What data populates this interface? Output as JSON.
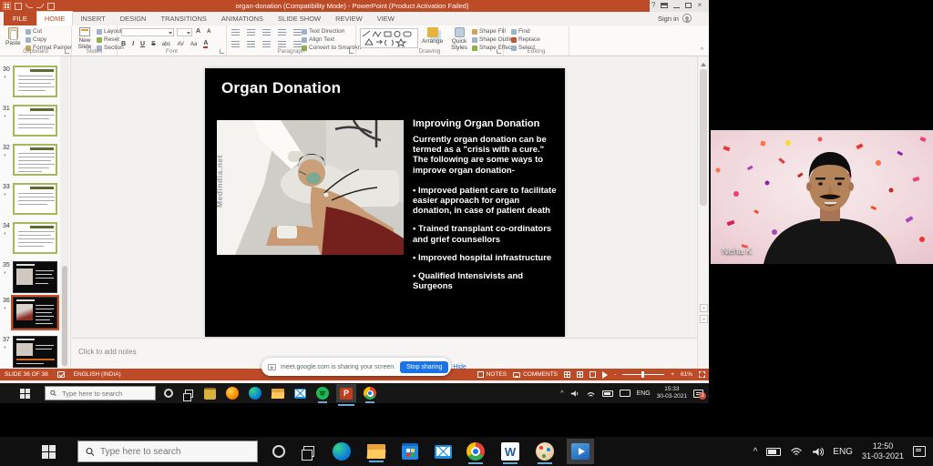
{
  "pp": {
    "title": "organ-donation (Compatibility Mode) - PowerPoint (Product Activation Failed)",
    "sign_in": "Sign in",
    "tabs": [
      "FILE",
      "HOME",
      "INSERT",
      "DESIGN",
      "TRANSITIONS",
      "ANIMATIONS",
      "SLIDE SHOW",
      "REVIEW",
      "VIEW"
    ],
    "ribbon": {
      "clipboard": {
        "group": "Clipboard",
        "paste": "Paste",
        "cut": "Cut",
        "copy": "Copy",
        "format_painter": "Format Painter"
      },
      "slides": {
        "group": "Slides",
        "new_slide": "New Slide",
        "layout": "Layout",
        "reset": "Reset",
        "section": "Section"
      },
      "font": {
        "group": "Font",
        "bold": "B",
        "italic": "I",
        "underline": "U",
        "strike": "S",
        "shadow": "abc",
        "spacing": "AV",
        "case": "Aa",
        "color": "A"
      },
      "paragraph": {
        "group": "Paragraph",
        "text_direction": "Text Direction",
        "align_text": "Align Text",
        "convert_smartart": "Convert to SmartArt"
      },
      "drawing": {
        "group": "Drawing",
        "arrange": "Arrange",
        "quick_styles": "Quick Styles",
        "shape_fill": "Shape Fill",
        "shape_outline": "Shape Outline",
        "shape_effects": "Shape Effects"
      },
      "editing": {
        "group": "Editing",
        "find": "Find",
        "replace": "Replace",
        "select": "Select"
      }
    },
    "thumbnails": [
      {
        "number": "30"
      },
      {
        "number": "31"
      },
      {
        "number": "32"
      },
      {
        "number": "33"
      },
      {
        "number": "34"
      },
      {
        "number": "35"
      },
      {
        "number": "36"
      },
      {
        "number": "37"
      }
    ],
    "slide": {
      "title": "Organ Donation",
      "watermark": "Medindia.net",
      "heading": "Improving Organ Donation",
      "intro": "Currently organ donation can be termed as a \"crisis with a cure.\" The following are some ways to improve organ donation-",
      "bullets": [
        "• Improved patient care to facilitate easier approach for organ donation, in case of patient death",
        "• Trained transplant co-ordinators and grief counsellors",
        "• Improved hospital infrastructure",
        "• Qualified Intensivists and Surgeons"
      ]
    },
    "notes_placeholder": "Click to add notes",
    "status": {
      "slide_counter": "SLIDE 36 OF 38",
      "language": "ENGLISH (INDIA)",
      "notes": "NOTES",
      "comments": "COMMENTS",
      "zoom": "61%"
    }
  },
  "meet_banner": {
    "message": "meet.google.com is sharing your screen.",
    "stop_button": "Stop sharing",
    "hide_link": "Hide",
    "accent": "#1A73E8"
  },
  "shared_taskbar": {
    "search_placeholder": "Type here to search",
    "language": "ENG",
    "time": "15:33",
    "date": "30-03-2021",
    "notification_count": "3"
  },
  "video": {
    "participant_name": "Neha K"
  },
  "local_taskbar": {
    "search_placeholder": "Type here to search",
    "language": "ENG",
    "time": "12:50",
    "date": "31-03-2021"
  },
  "icons": {
    "star": "*",
    "help": "?",
    "close": "×",
    "chevron_up": "^",
    "ppt_letter": "P",
    "word_letter": "W",
    "zoom_minus": "-",
    "zoom_plus": "+",
    "nav_prev": "«",
    "nav_next": "»"
  },
  "colors": {
    "accent_orange": "#BD4B27",
    "meet_blue": "#1A73E8",
    "open_underline": "#6AA8D8"
  }
}
